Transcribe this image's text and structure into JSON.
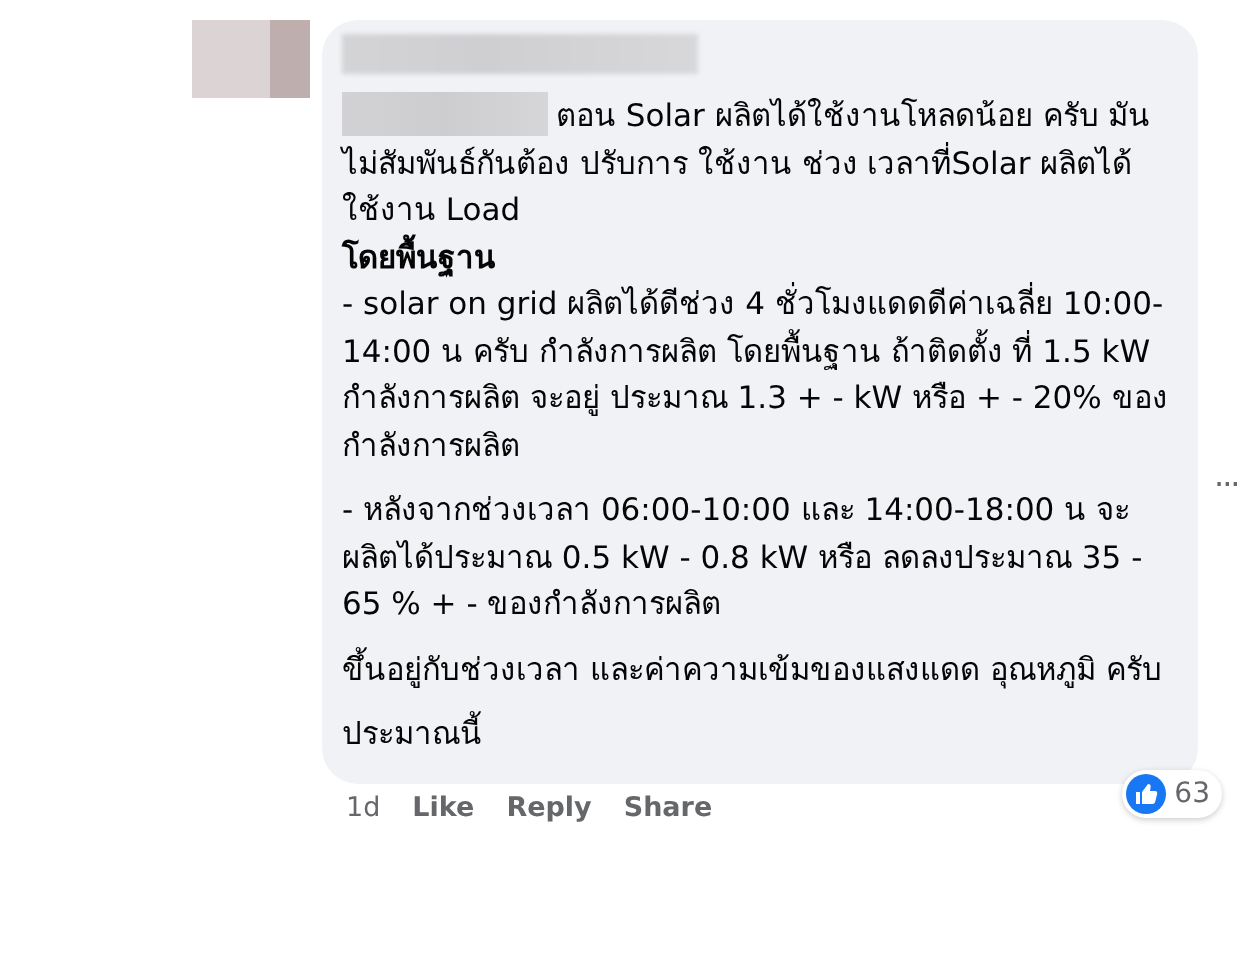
{
  "comment": {
    "paragraphs": [
      {
        "lines": [
          {
            "kind": "lead",
            "text": "ตอน Solar ผลิตได้ใช้งานโหลดน้อย ครับ มันไม่สัมพันธ์กันต้อง ปรับการ ใช้งาน ช่วง เวลาที่Solar ผลิตได้ ใช้งาน Load"
          },
          {
            "kind": "heading",
            "text": "โดยพื้นฐาน"
          },
          {
            "kind": "plain",
            "text": "- solar on grid ผลิตได้ดีช่วง 4 ชั่วโมงแดดดีค่าเฉลี่ย 10:00-14:00 น ครับ กำลังการผลิต โดยพื้นฐาน ถ้าติดตั้ง ที่ 1.5 kW กำลังการผลิต จะอยู่ ประมาณ 1.3 + - kW หรือ + - 20% ของกำลังการผลิต"
          }
        ]
      },
      {
        "lines": [
          {
            "kind": "plain",
            "text": "- หลังจากช่วงเวลา 06:00-10:00 และ 14:00-18:00 น จะผลิตได้ประมาณ 0.5 kW - 0.8 kW หรือ ลดลงประมาณ 35 - 65 % + - ของกำลังการผลิต"
          }
        ]
      },
      {
        "lines": [
          {
            "kind": "plain",
            "text": "ขึ้นอยู่กับช่วงเวลา และค่าความเข้มของแสงแดด อุณหภูมิ ครับ"
          }
        ]
      },
      {
        "lines": [
          {
            "kind": "plain",
            "text": "ประมาณนี้"
          }
        ]
      }
    ],
    "reaction_count": "63",
    "time": "1d",
    "actions": [
      "Like",
      "Reply",
      "Share"
    ],
    "more": "..."
  }
}
